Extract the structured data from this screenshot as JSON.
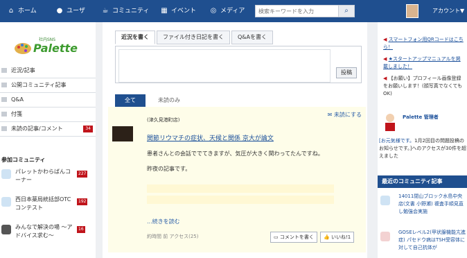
{
  "nav": {
    "home": "ホーム",
    "user": "ユーザ",
    "community": "コミュニティ",
    "event": "イベント",
    "media": "メディア",
    "search_placeholder": "検索キーワードを入力",
    "account": "アカウント▼"
  },
  "logo": {
    "small": "社内SNS",
    "big": "Palette"
  },
  "menu": [
    {
      "label": "近況/記事"
    },
    {
      "label": "公開コミュニティ記事"
    },
    {
      "label": "Q&A"
    },
    {
      "label": "付箋"
    },
    {
      "label": "未読の記事/コメント",
      "badge": "34"
    }
  ],
  "communities": {
    "title": "参加コミュニティ",
    "items": [
      {
        "name": "パレットかわらばんコーナー",
        "badge": "227"
      },
      {
        "name": "西日本薬局統括部OTCコンテスト",
        "badge": "192"
      },
      {
        "name": "みんなで解決の場 〜アドバイス求む〜",
        "badge": "16"
      }
    ]
  },
  "post_tabs": [
    "近況を書く",
    "ファイル付き日記を書く",
    "Q&Aを書く"
  ],
  "post_button": "投稿",
  "feed_tabs": [
    "全て",
    "未読のみ"
  ],
  "feed": {
    "unread_label": "✉ 未読にする",
    "author": "(津久見港町店)",
    "title": "関節リウマチの症状、天候と関係 京大が論文",
    "body1": "患者さんとの会話ででてきますが、気圧が大きく関わってたんですね。",
    "body2": "昨夜の記事です。",
    "read_more": "...続きを読む",
    "meta": "約時間 前 アクセス(25)",
    "comment_btn": "コメントを書く",
    "like_btn": "いいね!",
    "like_count": "1"
  },
  "right": {
    "notice1": "スマートフォン用QRコードはこちら！",
    "notice2": "★スタートアップマニュアルを掲載しました！",
    "notice3": "【お願い】プロフィール画像登録をお願いします！(顔写真でなくてもOK)",
    "profile_name": "Palette 管理者",
    "profile_msg_lead": "[お元気様です。",
    "profile_msg_rest": "1月2回目の問題投稿のお知らせです。]へのアクセスが30件を超えました",
    "recent_title": "最近のコミュニティ記事",
    "recent1": "14011閉山ブロック水島中央店(文書 小野瀬) 複査手順見直し勉強会実施",
    "recent2": "GOSEレベル2(甲状腺機能亢進症) パセドウ病はTSH受容体に対して自己抗体が"
  },
  "colors": {
    "nav_bg": "#1f4f8f",
    "badge": "#c0141b",
    "feed_bg": "#fefde9"
  }
}
